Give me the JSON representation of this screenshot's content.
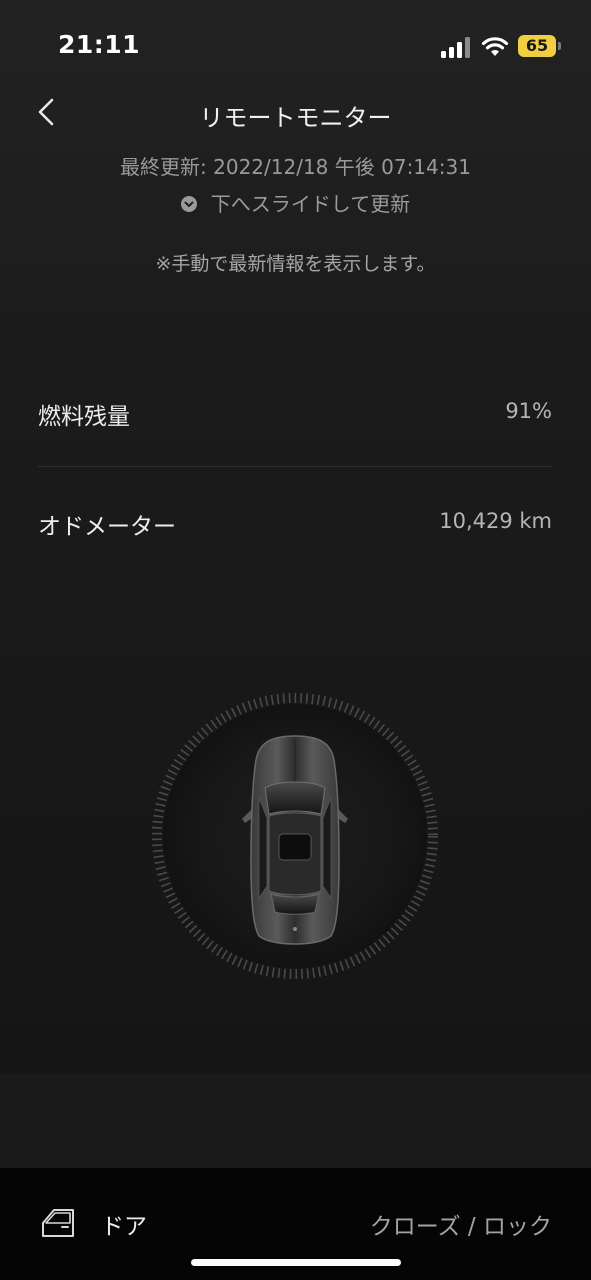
{
  "status_bar": {
    "time": "21:11",
    "battery_level": "65",
    "icons": [
      "signal-icon",
      "wifi-icon",
      "battery-icon"
    ],
    "battery_color": "#f0cf45"
  },
  "header": {
    "back_icon": "chevron-left-icon",
    "title": "リモートモニター"
  },
  "update": {
    "last_update": "最終更新: 2022/12/18 午後 07:14:31",
    "slide_hint": "下へスライドして更新",
    "slide_icon": "chevron-down-circle-icon",
    "manual_note": "※手動で最新情報を表示します。"
  },
  "info": {
    "fuel": {
      "label": "燃料残量",
      "value": "91%"
    },
    "odometer": {
      "label": "オドメーター",
      "value": "10,429 km"
    }
  },
  "vehicle": {
    "image": "car-top-view-icon"
  },
  "footer": {
    "door_icon": "car-door-icon",
    "door_label": "ドア",
    "door_status": "クローズ / ロック"
  }
}
